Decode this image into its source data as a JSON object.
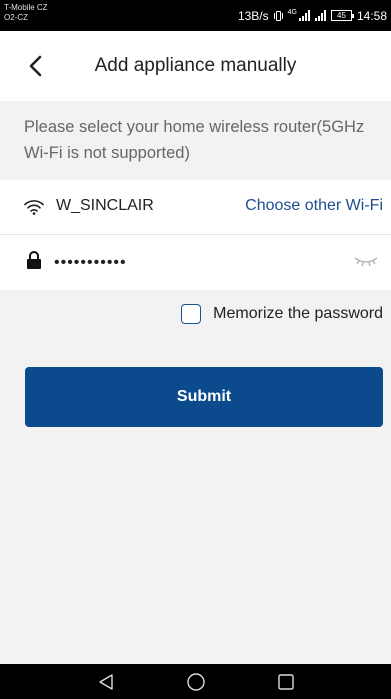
{
  "status_bar": {
    "carrier_line1": "T-Mobile CZ",
    "carrier_line2": "O2-CZ",
    "net_speed": "13B/s",
    "network_type": "4G",
    "battery": "45",
    "time": "14:58"
  },
  "header": {
    "title": "Add appliance manually",
    "back_icon": "chevron-left-icon"
  },
  "instructions": "Please select your home wireless router(5GHz Wi-Fi is not supported)",
  "wifi": {
    "ssid": "W_SINCLAIR",
    "choose_other_label": "Choose other Wi-Fi",
    "icon": "wifi-icon"
  },
  "password": {
    "value": "•••••••••••",
    "lock_icon": "lock-icon",
    "toggle_icon": "eye-closed-icon"
  },
  "memorize": {
    "label": "Memorize the password",
    "checked": false
  },
  "submit": {
    "label": "Submit"
  },
  "nav": {
    "back": "nav-back-icon",
    "home": "nav-home-icon",
    "recent": "nav-recent-icon"
  },
  "colors": {
    "accent": "#0c4a8e",
    "link": "#1d4e8f",
    "background": "#f2f2f2",
    "text_secondary": "#666666"
  }
}
